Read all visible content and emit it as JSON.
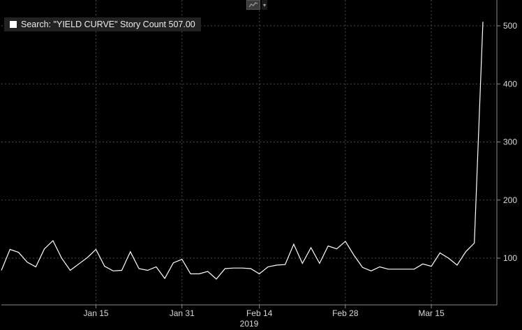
{
  "toolbar": {
    "chart_type_icon": "line-chart-icon",
    "dropdown_icon": "chevron-down-icon"
  },
  "legend": {
    "text": "Search: \"YIELD CURVE\" Story Count 507.00",
    "swatch_color": "#ffffff"
  },
  "chart_data": {
    "type": "line",
    "title": "",
    "xlabel": "2019",
    "ylabel": "",
    "ylim": [
      30,
      530
    ],
    "yticks": [
      100,
      200,
      300,
      400,
      500
    ],
    "x_ticks": [
      "Jan 15",
      "Jan 31",
      "Feb 14",
      "Feb 28",
      "Mar 15"
    ],
    "year_label": "2019",
    "line_color": "#ffffff",
    "grid": true,
    "series": [
      {
        "name": "Search: \"YIELD CURVE\" Story Count",
        "values": [
          79,
          115,
          110,
          93,
          85,
          116,
          130,
          100,
          79,
          90,
          101,
          115,
          86,
          78,
          79,
          111,
          82,
          79,
          85,
          65,
          92,
          98,
          73,
          73,
          77,
          64,
          82,
          83,
          83,
          82,
          73,
          85,
          88,
          89,
          124,
          91,
          118,
          91,
          121,
          116,
          129,
          105,
          84,
          78,
          85,
          81,
          81,
          81,
          81,
          90,
          86,
          109,
          100,
          88,
          111,
          126,
          507
        ]
      }
    ]
  }
}
